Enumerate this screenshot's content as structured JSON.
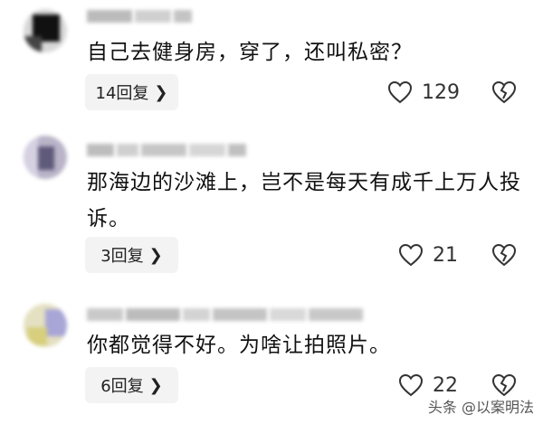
{
  "comments": [
    {
      "text": "自己去健身房，穿了，还叫私密？",
      "reply_label": "14回复",
      "likes": "129"
    },
    {
      "text": "那海边的沙滩上，岂不是每天有成千上万人投诉。",
      "reply_label": "3回复",
      "likes": "21"
    },
    {
      "text": "你都觉得不好。为啥让拍照片。",
      "reply_label": "6回复",
      "likes": "22"
    }
  ],
  "watermark": "头条 @以案明法",
  "icons": {
    "like": "heart-outline-icon",
    "dislike": "broken-heart-icon",
    "reply_chevron": "chevron-right-icon"
  }
}
